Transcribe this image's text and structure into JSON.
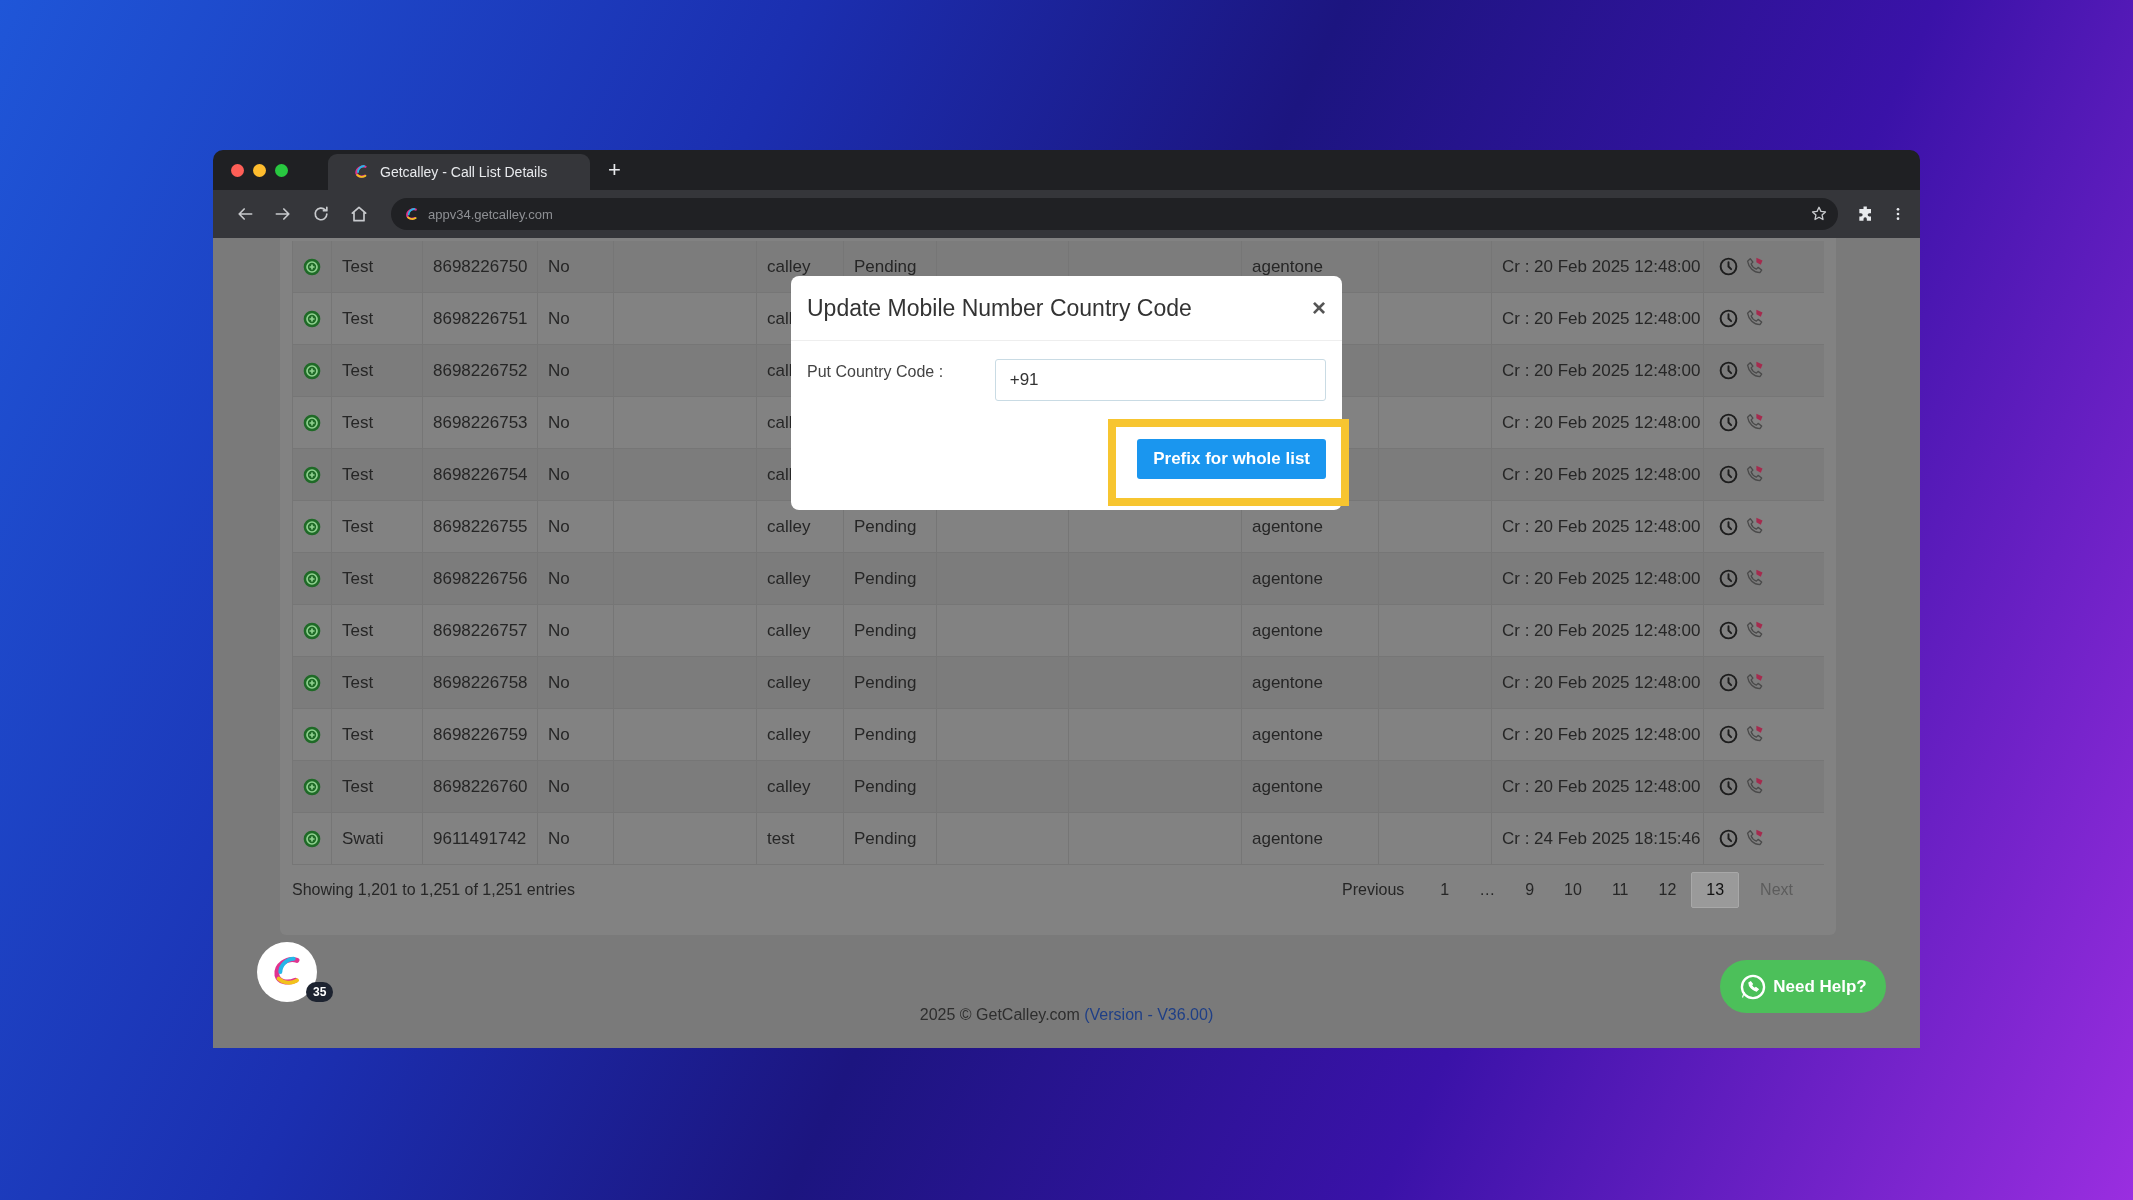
{
  "browser": {
    "tab_title": "Getcalley - Call List Details",
    "new_tab": "+",
    "url": "appv34.getcalley.com"
  },
  "table": {
    "rows": [
      {
        "column_2": "Test",
        "column_3": "8698226750",
        "column_4": "No",
        "column_6": "calley",
        "column_7": "Pending",
        "column_10": "agentone",
        "column_12": "Cr : 20 Feb 2025 12:48:00"
      },
      {
        "column_2": "Test",
        "column_3": "8698226751",
        "column_4": "No",
        "column_6": "call",
        "column_12": "Cr : 20 Feb 2025 12:48:00"
      },
      {
        "column_2": "Test",
        "column_3": "8698226752",
        "column_4": "No",
        "column_6": "call",
        "column_12": "Cr : 20 Feb 2025 12:48:00"
      },
      {
        "column_2": "Test",
        "column_3": "8698226753",
        "column_4": "No",
        "column_6": "call",
        "column_12": "Cr : 20 Feb 2025 12:48:00"
      },
      {
        "column_2": "Test",
        "column_3": "8698226754",
        "column_4": "No",
        "column_6": "call",
        "column_12": "Cr : 20 Feb 2025 12:48:00"
      },
      {
        "column_2": "Test",
        "column_3": "8698226755",
        "column_4": "No",
        "column_6": "calley",
        "column_7": "Pending",
        "column_10": "agentone",
        "column_12": "Cr : 20 Feb 2025 12:48:00"
      },
      {
        "column_2": "Test",
        "column_3": "8698226756",
        "column_4": "No",
        "column_6": "calley",
        "column_7": "Pending",
        "column_10": "agentone",
        "column_12": "Cr : 20 Feb 2025 12:48:00"
      },
      {
        "column_2": "Test",
        "column_3": "8698226757",
        "column_4": "No",
        "column_6": "calley",
        "column_7": "Pending",
        "column_10": "agentone",
        "column_12": "Cr : 20 Feb 2025 12:48:00"
      },
      {
        "column_2": "Test",
        "column_3": "8698226758",
        "column_4": "No",
        "column_6": "calley",
        "column_7": "Pending",
        "column_10": "agentone",
        "column_12": "Cr : 20 Feb 2025 12:48:00"
      },
      {
        "column_2": "Test",
        "column_3": "8698226759",
        "column_4": "No",
        "column_6": "calley",
        "column_7": "Pending",
        "column_10": "agentone",
        "column_12": "Cr : 20 Feb 2025 12:48:00"
      },
      {
        "column_2": "Test",
        "column_3": "8698226760",
        "column_4": "No",
        "column_6": "calley",
        "column_7": "Pending",
        "column_10": "agentone",
        "column_12": "Cr : 20 Feb 2025 12:48:00"
      },
      {
        "column_2": "Swati",
        "column_3": "9611491742",
        "column_4": "No",
        "column_6": "test",
        "column_7": "Pending",
        "column_10": "agentone",
        "column_12": "Cr : 24 Feb 2025 18:15:46"
      }
    ],
    "info": "Showing 1,201 to 1,251 of 1,251 entries",
    "pagination": [
      {
        "kind": "nav",
        "label": "Previous",
        "selected": false,
        "disabled": false
      },
      {
        "kind": "page",
        "label": "1",
        "selected": false,
        "disabled": false
      },
      {
        "kind": "ellipsis",
        "label": "…"
      },
      {
        "kind": "page",
        "label": "9",
        "selected": false,
        "disabled": false
      },
      {
        "kind": "page",
        "label": "10",
        "selected": false,
        "disabled": false
      },
      {
        "kind": "page",
        "label": "11",
        "selected": false,
        "disabled": false
      },
      {
        "kind": "page",
        "label": "12",
        "selected": false,
        "disabled": false
      },
      {
        "kind": "page",
        "label": "13",
        "selected": true,
        "disabled": false
      },
      {
        "kind": "nav",
        "label": "Next",
        "selected": false,
        "disabled": true
      }
    ]
  },
  "modal": {
    "title": "Update Mobile Number Country Code",
    "close": "×",
    "label": "Put Country Code :",
    "value": "+91",
    "button": "Prefix for whole list",
    "highlighted": true
  },
  "chat_widget": {
    "badge": "35"
  },
  "help_button": "Need Help?",
  "footer": {
    "text": "2025 © GetCalley.com",
    "link": "(Version - V36.00)"
  }
}
